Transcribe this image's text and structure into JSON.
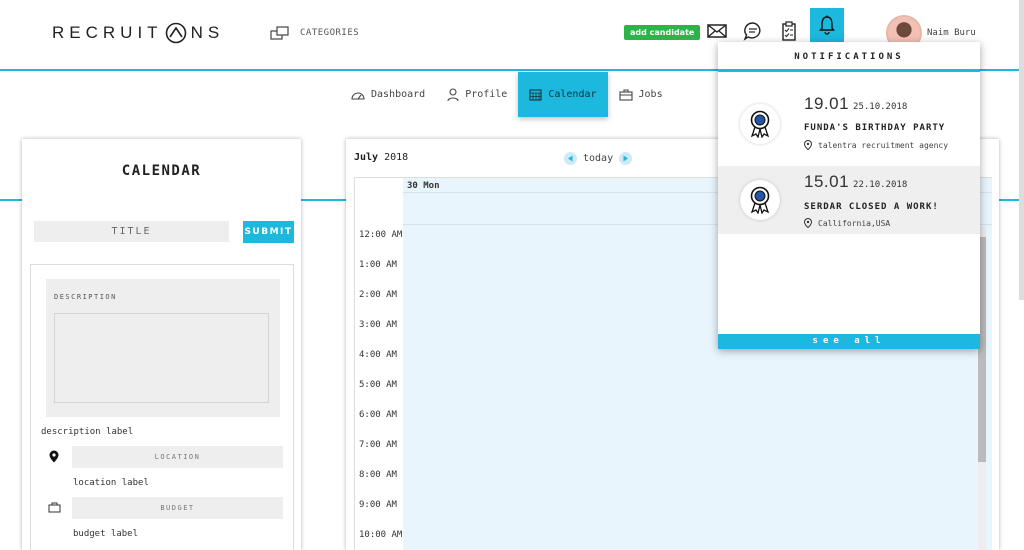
{
  "header": {
    "logo_text_left": "RECRUIT",
    "logo_text_right": "NS",
    "categories_label": "CATEGORIES",
    "add_candidate_label": "add candidate",
    "user_name": "Naim Buru",
    "icons": [
      "mail-icon",
      "chat-icon",
      "clipboard-icon",
      "bell-icon"
    ]
  },
  "nav": {
    "items": [
      {
        "label": "Dashboard",
        "icon": "dashboard-icon"
      },
      {
        "label": "Profile",
        "icon": "profile-icon"
      },
      {
        "label": "Calendar",
        "icon": "calendar-icon",
        "active": true
      },
      {
        "label": "Jobs",
        "icon": "briefcase-icon"
      }
    ]
  },
  "calendar_form": {
    "title": "CALENDAR",
    "title_input": "TITLE",
    "submit_label": "SUBMIT",
    "description_label_top": "DESCRIPTION",
    "description_label": "description label",
    "location_input": "LOCATION",
    "location_label": "location label",
    "budget_input": "BUDGET",
    "budget_label": "budget label"
  },
  "schedule": {
    "month": "July",
    "year": "2018",
    "today_label": "today",
    "day_column": "30 Mon",
    "times": [
      "12:00 AM",
      "1:00 AM",
      "2:00 AM",
      "3:00 AM",
      "4:00 AM",
      "5:00 AM",
      "6:00 AM",
      "7:00 AM",
      "8:00 AM",
      "9:00 AM",
      "10:00 AM"
    ]
  },
  "notifications": {
    "heading": "NOTIFICATIONS",
    "items": [
      {
        "date_big": "19.01",
        "date_small": "25.10.2018",
        "title": "FUNDA'S BIRTHDAY PARTY",
        "location": "talentra recruitment agency"
      },
      {
        "date_big": "15.01",
        "date_small": "22.10.2018",
        "title": "SERDAR CLOSED A WORK!",
        "location": "Callifornia,USA"
      }
    ],
    "see_all_label": "see all"
  },
  "colors": {
    "accent": "#1cb8dd",
    "add_candidate": "#2eb34a",
    "calendar_fill": "#e9f5fd"
  }
}
